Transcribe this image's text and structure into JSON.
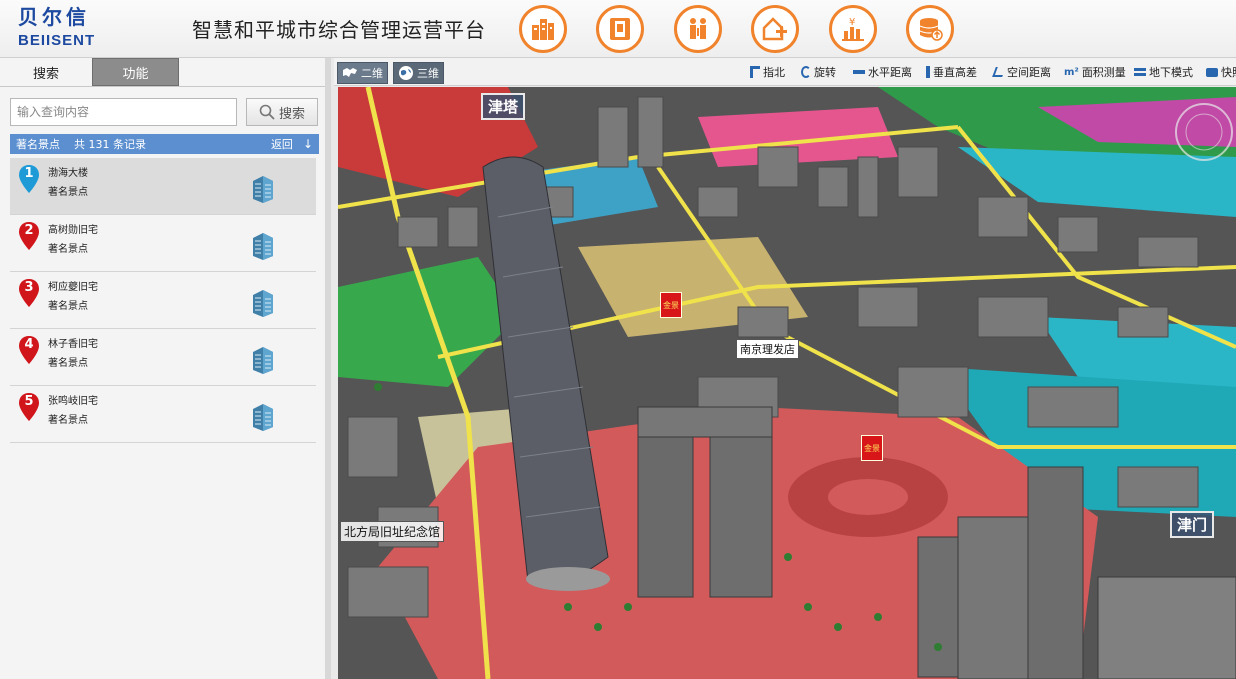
{
  "header": {
    "logo_cn": "贝尔信",
    "logo_en": "BEIISENT",
    "title": "智慧和平城市综合管理运营平台",
    "nav_icons": [
      "buildings-icon",
      "phone-book-icon",
      "people-icon",
      "house-plus-icon",
      "finance-chart-icon",
      "database-upload-icon"
    ],
    "accent_color": "#f0832b"
  },
  "sidebar": {
    "tabs": [
      {
        "label": "搜索"
      },
      {
        "label": "功能"
      }
    ],
    "search": {
      "placeholder": "输入查询内容",
      "button": "搜索"
    },
    "result_bar": {
      "category": "著名景点",
      "count": "共 131 条记录",
      "back": "返回",
      "arrow": "↓"
    },
    "items": [
      {
        "num": "1",
        "name": "渤海大楼",
        "type": "著名景点",
        "pin_color": "#1e9bd7"
      },
      {
        "num": "2",
        "name": "高树勋旧宅",
        "type": "著名景点",
        "pin_color": "#d0151b"
      },
      {
        "num": "3",
        "name": "柯应夔旧宅",
        "type": "著名景点",
        "pin_color": "#d0151b"
      },
      {
        "num": "4",
        "name": "林子香旧宅",
        "type": "著名景点",
        "pin_color": "#d0151b"
      },
      {
        "num": "5",
        "name": "张鸣岐旧宅",
        "type": "著名景点",
        "pin_color": "#d0151b"
      }
    ]
  },
  "toolbar": {
    "mode_2d": "二维",
    "mode_3d": "三维",
    "tools": [
      "指北",
      "旋转",
      "水平距离",
      "垂直高差",
      "空间距离",
      "面积测量",
      "地下模式",
      "快照"
    ]
  },
  "map": {
    "labels": {
      "tower_top": "津塔",
      "shop": "南京理发店",
      "gate": "津门",
      "memorial": "北方局旧址纪念馆",
      "poi_tag": "金景"
    }
  }
}
